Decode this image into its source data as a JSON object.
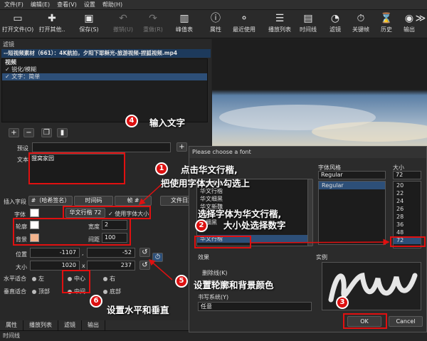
{
  "menu": [
    "文件(F)",
    "编辑(E)",
    "查看(V)",
    "设置",
    "帮助(H)"
  ],
  "toolbar": [
    {
      "label": "打开文件(O)",
      "icon": "folder-icon",
      "glyph": "▭",
      "enabled": true
    },
    {
      "label": "打开其他..",
      "icon": "open-other-icon",
      "glyph": "✚",
      "enabled": true
    },
    {
      "label": "保存(S)",
      "icon": "save-icon",
      "glyph": "▣",
      "enabled": true
    },
    {
      "label": "撤销(U)",
      "icon": "undo-icon",
      "glyph": "↶",
      "enabled": false
    },
    {
      "label": "重做(R)",
      "icon": "redo-icon",
      "glyph": "↷",
      "enabled": false
    },
    {
      "label": "峰值表",
      "icon": "meter-icon",
      "glyph": "▥",
      "enabled": true
    },
    {
      "label": "属性",
      "icon": "info-icon",
      "glyph": "ⓘ",
      "enabled": true
    },
    {
      "label": "最近使用",
      "icon": "recent-icon",
      "glyph": "⚬",
      "enabled": true
    },
    {
      "label": "播放列表",
      "icon": "playlist-icon",
      "glyph": "☰",
      "enabled": true
    },
    {
      "label": "时间线",
      "icon": "timeline-icon",
      "glyph": "▤",
      "enabled": true
    },
    {
      "label": "滤镜",
      "icon": "filter-icon",
      "glyph": "◔",
      "enabled": true
    },
    {
      "label": "关键帧",
      "icon": "keyframe-icon",
      "glyph": "⏱",
      "enabled": true
    },
    {
      "label": "历史",
      "icon": "history-icon",
      "glyph": "⌛",
      "enabled": true
    },
    {
      "label": "输出",
      "icon": "export-icon",
      "glyph": "◉",
      "enabled": true
    },
    {
      "label": "",
      "icon": "more-icon",
      "glyph": "≫",
      "enabled": true
    }
  ],
  "left": {
    "panel_title": "滤镜",
    "clip_name": "--短视频素材（661）：4K航拍，夕阳下耶稣光-旅游视频-捏狐视频.mp4",
    "section": "视频",
    "filters": [
      {
        "label": "✓  锐化/模糊",
        "selected": false
      },
      {
        "label": "✓  文字：简单",
        "selected": true
      }
    ],
    "preset_label": "预设",
    "text_label": "文本",
    "text_value": "狸窝家园",
    "insert_field_label": "插入字段",
    "insert_buttons": [
      "#（哈希签名）",
      "时间码",
      "帧 #",
      "文件日期"
    ],
    "font_label": "字体",
    "font_name": "华文行楷 72",
    "use_font_size": "✓ 使用字体大小",
    "outline_label": "轮廓",
    "width_label": "宽度",
    "width_value": "2",
    "bg_label": "背景",
    "padding_label": "间距",
    "padding_value": "100",
    "position_label": "位置",
    "pos_x": "-1107",
    "pos_y": "-52",
    "pos_sep": ",",
    "size_label": "大小",
    "size_w": "1020",
    "size_h": "237",
    "size_sep": "x",
    "halign_label": "水平适合",
    "halign": [
      "左",
      "中心",
      "右"
    ],
    "valign_label": "垂直适合",
    "valign": [
      "顶部",
      "中间",
      "底部"
    ],
    "colors": {
      "font_swatch": "#ffffff",
      "outline_swatch": "#ffffff",
      "bg_swatch": "#f3b48e"
    }
  },
  "bottom_tabs": [
    "属性",
    "播放列表",
    "滤镜",
    "输出"
  ],
  "timeline_label": "时间线",
  "dialog": {
    "title": "Please choose a font",
    "family_items": [
      "华文宋体",
      "华文行楷",
      "华文细黑",
      "华文新魏",
      "文楷",
      "文细黑",
      "华文行楷"
    ],
    "style_label": "字体风格",
    "style_value": "Regular",
    "style_items": [
      "Regular"
    ],
    "size_label": "大小",
    "size_value": "72",
    "size_items": [
      "20",
      "22",
      "24",
      "26",
      "28",
      "36",
      "48",
      "72"
    ],
    "effects_label": "效果",
    "strike_label": "删除线(K)",
    "underline_label": "下划线(U)",
    "sample_label": "实例",
    "writing_system_label": "书写系统(Y)",
    "writing_system_value": "任意",
    "ok": "OK",
    "cancel": "Cancel"
  },
  "annotations": {
    "n1": "1",
    "t1a": "点击华文行楷,",
    "t1b": "把使用字体大小勾选上",
    "n2": "2",
    "t2a": "选择字体为华文行楷,",
    "t2b": "大小处选择数字",
    "n3": "3",
    "n4": "4",
    "t4": "输入文字",
    "n5": "5",
    "t5": "设置轮廓和背景颜色",
    "n6": "6",
    "t6": "设置水平和垂直"
  }
}
